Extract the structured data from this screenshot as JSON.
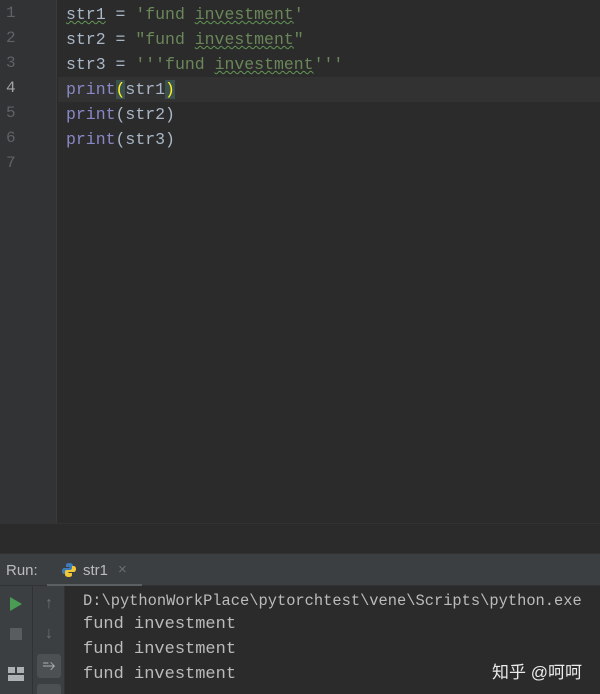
{
  "editor": {
    "line_numbers": [
      "1",
      "2",
      "3",
      "4",
      "5",
      "6",
      "7"
    ],
    "current_line": 4,
    "lines": [
      {
        "var": "str1",
        "op": " = ",
        "q_open": "'",
        "s1": "fund ",
        "s2": "investment",
        "q_close": "'"
      },
      {
        "var": "str2",
        "op": " = ",
        "q_open": "\"",
        "s1": "fund ",
        "s2": "investment",
        "q_close": "\""
      },
      {
        "var": "str3",
        "op": " = ",
        "q_open": "'''",
        "s1": "fund ",
        "s2": "investment",
        "q_close": "'''"
      },
      {
        "fn": "print",
        "open": "(",
        "arg": "str1",
        "close": ")"
      },
      {
        "fn": "print",
        "open": "(",
        "arg": "str2",
        "close": ")"
      },
      {
        "fn": "print",
        "open": "(",
        "arg": "str3",
        "close": ")"
      }
    ]
  },
  "run": {
    "label": "Run:",
    "tab_label": "str1",
    "close": "×",
    "console": [
      "D:\\pythonWorkPlace\\pytorchtest\\vene\\Scripts\\python.exe",
      "fund investment",
      "fund investment",
      "fund investment"
    ]
  },
  "watermark": "知乎 @呵呵",
  "colors": {
    "run_green": "#499c54",
    "string": "#6a8759",
    "keyword": "#8888c6"
  }
}
